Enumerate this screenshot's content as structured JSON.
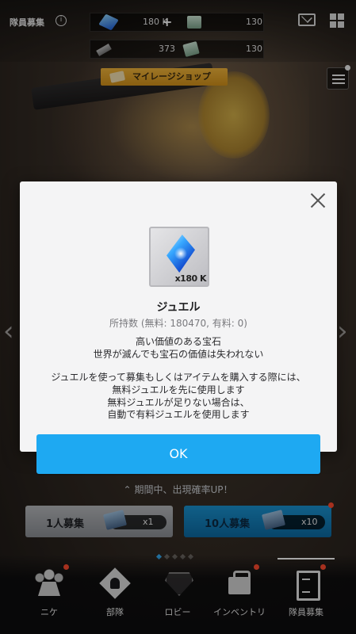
{
  "top_bar": {
    "title": "隊員募集",
    "resources": [
      {
        "icon": "jewel-icon",
        "value": "180 K"
      },
      {
        "icon": "ticket-icon",
        "value": "130"
      },
      {
        "icon": "bullet-icon",
        "value": "373"
      },
      {
        "icon": "ticket-icon",
        "value": "130"
      }
    ],
    "plus_label": "+"
  },
  "mileage_shop": {
    "label": "マイレージショップ"
  },
  "modal": {
    "item_count": "x180 K",
    "item_name": "ジュエル",
    "owned_text": "所持数 (無料: 180470, 有料: 0)",
    "description": [
      "高い価値のある宝石",
      "世界が滅んでも宝石の価値は失われない",
      "ジュエルを使って募集もしくはアイテムを購入する際には、",
      "無料ジュエルを先に使用します",
      "無料ジュエルが足りない場合は、",
      "自動で有料ジュエルを使用します"
    ],
    "ok_label": "OK"
  },
  "rate_up": {
    "text": "期間中、出現確率UP！"
  },
  "recruit": {
    "single": {
      "label": "1人募集",
      "count": "x1"
    },
    "ten": {
      "label": "10人募集",
      "count": "x10"
    }
  },
  "nav": [
    {
      "label": "ニケ"
    },
    {
      "label": "部隊"
    },
    {
      "label": "ロビー"
    },
    {
      "label": "インベントリ"
    },
    {
      "label": "隊員募集"
    }
  ],
  "colors": {
    "ok_button": "#1ea9f2",
    "notification_dot": "#ff4b2e",
    "mileage_button": "#f2b53b"
  }
}
